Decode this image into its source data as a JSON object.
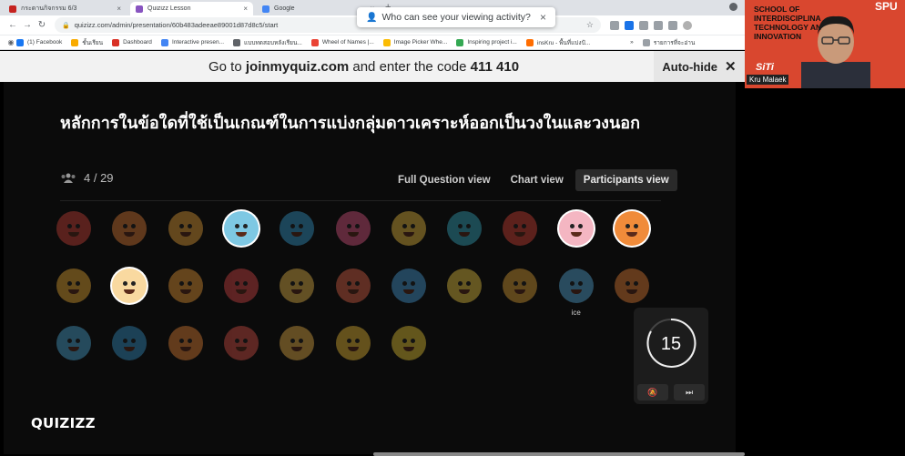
{
  "browser": {
    "tabs": [
      {
        "title": "กระดานกิจกรรม 6/3",
        "fav_color": "#c5221f",
        "active": false
      },
      {
        "title": "Quizizz Lesson",
        "fav_color": "#8854c0",
        "active": true
      },
      {
        "title": "Google",
        "fav_color": "#4285f4",
        "active": false
      }
    ],
    "tab_close": "×",
    "new_tab": "+",
    "url": "quizizz.com/admin/presentation/60b483adeeae89001d87d8c5/start",
    "popup": {
      "text": "Who can see your viewing activity?",
      "close": "×"
    },
    "bookmarks": [
      {
        "label": "(1) Facebook",
        "color": "#1877f2"
      },
      {
        "label": "ชั้นเรียน",
        "color": "#f9ab00"
      },
      {
        "label": "Dashboard",
        "color": "#d93025"
      },
      {
        "label": "Interactive presen...",
        "color": "#4285f4"
      },
      {
        "label": "แบบทดสอบหลังเรียน...",
        "color": "#5f6368"
      },
      {
        "label": "Wheel of Names |...",
        "color": "#ea4335"
      },
      {
        "label": "Image Picker Whe...",
        "color": "#fbbc04"
      },
      {
        "label": "Inspiring project i...",
        "color": "#34a853"
      },
      {
        "label": "insKru - พื้นที่แบ่งปั...",
        "color": "#ff6d00"
      }
    ],
    "bookmarks_more": "»",
    "reading_list": "รายการที่จะอ่าน"
  },
  "banner": {
    "prefix": "Go to ",
    "site": "joinmyquiz.com",
    "middle": " and enter the code ",
    "code": "411 410",
    "autohide_label": "Auto-hide",
    "autohide_close": "✕"
  },
  "quiz": {
    "question": "หลักการในข้อใดที่ใช้เป็นเกณฑ์ในการแบ่งกลุ่มดาวเคราะห์ออกเป็นวงในและวงนอก",
    "participants_count": "4 / 29",
    "view_tabs": [
      {
        "label": "Full Question view",
        "active": false
      },
      {
        "label": "Chart view",
        "active": false
      },
      {
        "label": "Participants view",
        "active": true
      }
    ],
    "avatars": [
      {
        "color": "#d7473c",
        "joined": false,
        "label": ""
      },
      {
        "color": "#e8833a",
        "joined": false,
        "label": ""
      },
      {
        "color": "#f2a93b",
        "joined": false,
        "label": ""
      },
      {
        "color": "#7ec8e3",
        "joined": true,
        "label": ""
      },
      {
        "color": "#3aa3d9",
        "joined": false,
        "label": ""
      },
      {
        "color": "#e85a8a",
        "joined": false,
        "label": ""
      },
      {
        "color": "#f4c542",
        "joined": false,
        "label": ""
      },
      {
        "color": "#3ab0c9",
        "joined": false,
        "label": ""
      },
      {
        "color": "#e0463a",
        "joined": false,
        "label": ""
      },
      {
        "color": "#f4b6c2",
        "joined": true,
        "label": ""
      },
      {
        "color": "#f08b3a",
        "joined": true,
        "label": ""
      },
      {
        "color": "#f2b035",
        "joined": false,
        "label": ""
      },
      {
        "color": "#f9d9a0",
        "joined": true,
        "label": ""
      },
      {
        "color": "#f4a03a",
        "joined": false,
        "label": ""
      },
      {
        "color": "#e24a4a",
        "joined": false,
        "label": ""
      },
      {
        "color": "#f2c14e",
        "joined": false,
        "label": ""
      },
      {
        "color": "#e8674a",
        "joined": false,
        "label": ""
      },
      {
        "color": "#4aa3e0",
        "joined": false,
        "label": ""
      },
      {
        "color": "#f5d046",
        "joined": false,
        "label": ""
      },
      {
        "color": "#e9a83a",
        "joined": false,
        "label": ""
      },
      {
        "color": "#5bb4e5",
        "joined": false,
        "label": "ice"
      },
      {
        "color": "#f2883a",
        "joined": false,
        "label": ""
      },
      {
        "color": "#4fb0e0",
        "joined": false,
        "label": ""
      },
      {
        "color": "#3a9ad0",
        "joined": false,
        "label": ""
      },
      {
        "color": "#f08a3a",
        "joined": false,
        "label": ""
      },
      {
        "color": "#e2554a",
        "joined": false,
        "label": ""
      },
      {
        "color": "#f2b84a",
        "joined": false,
        "label": ""
      },
      {
        "color": "#f4c33a",
        "joined": false,
        "label": ""
      },
      {
        "color": "#f2d03a",
        "joined": false,
        "label": ""
      }
    ],
    "timer": {
      "value": "15",
      "mute_icon": "🔕",
      "skip_icon": "⏭"
    },
    "logo": "QUIZIZZ"
  },
  "webcam": {
    "school_text": [
      "SCHOOL OF",
      "INTERDISCIPLINA",
      "TECHNOLOGY AN",
      "INNOVATION"
    ],
    "brand": "SPU",
    "siti": "SiTi",
    "name": "Kru Malaek",
    "bg_color": "#d9472f"
  }
}
